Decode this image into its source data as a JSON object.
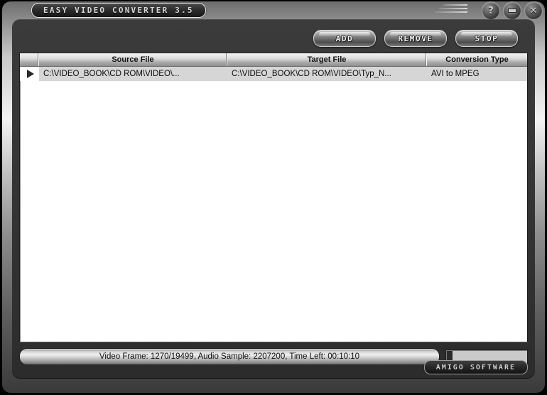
{
  "window": {
    "title": "EASY VIDEO CONVERTER 3.5",
    "controls": [
      {
        "name": "help-button",
        "glyph": "?"
      },
      {
        "name": "minimize-button",
        "glyph": ""
      },
      {
        "name": "close-button",
        "glyph": "✕"
      }
    ]
  },
  "toolbar": {
    "add_label": "ADD",
    "remove_label": "REMOVE",
    "stop_label": "STOP"
  },
  "list": {
    "columns": [
      "",
      "Source File",
      "Target File",
      "Conversion Type"
    ],
    "rows": [
      {
        "marker": "play-triangle",
        "source_file": "C:\\VIDEO_BOOK\\CD ROM\\VIDEO\\...",
        "target_file": "C:\\VIDEO_BOOK\\CD ROM\\VIDEO\\Typ_N...",
        "conversion_type": "AVI to MPEG"
      }
    ]
  },
  "status": {
    "text": "Video Frame: 1270/19499, Audio Sample: 2207200, Time Left: 00:10:10",
    "progress_percent": 7
  },
  "brand": {
    "label": "AMIGO SOFTWARE"
  },
  "colors": {
    "frame_silver": "#c9c9c9",
    "panel_dark": "#343434",
    "list_background": "#ffffff",
    "row_selected": "#d6d6d6",
    "progress_fill": "#2b2b2b"
  }
}
